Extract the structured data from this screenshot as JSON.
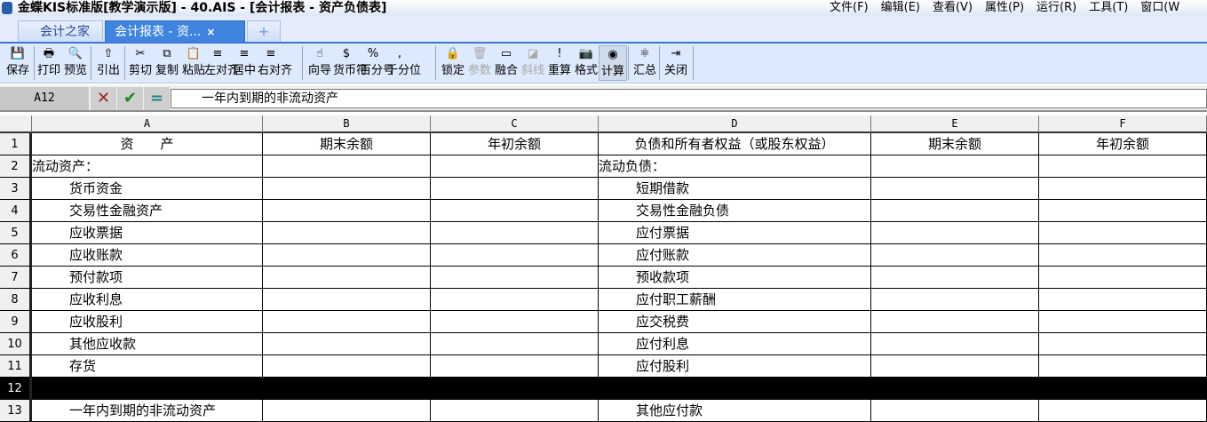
{
  "window": {
    "title": "金蝶KIS标准版[教学演示版] - 40.AIS - [会计报表 - 资产负债表]",
    "menu": [
      "文件(F)",
      "编辑(E)",
      "查看(V)",
      "属性(P)",
      "运行(R)",
      "工具(T)",
      "窗口(W"
    ]
  },
  "tabs": [
    {
      "label": "会计之家",
      "active": false
    },
    {
      "label": "会计报表 - 资...",
      "active": true,
      "close": "×"
    },
    {
      "label": "+",
      "new": true
    }
  ],
  "toolbar": [
    {
      "label": "保存",
      "icon": "save-icon",
      "glyph": "💾"
    },
    {
      "label": "打印",
      "icon": "print-icon",
      "glyph": "🖶"
    },
    {
      "label": "预览",
      "icon": "preview-icon",
      "glyph": "🔍"
    },
    {
      "label": "引出",
      "icon": "export-icon",
      "glyph": "⇧"
    },
    {
      "label": "剪切",
      "icon": "cut-icon",
      "glyph": "✂"
    },
    {
      "label": "复制",
      "icon": "copy-icon",
      "glyph": "⧉"
    },
    {
      "label": "粘贴",
      "icon": "paste-icon",
      "glyph": "📋"
    },
    {
      "label": "左对齐",
      "icon": "align-left-icon",
      "glyph": "≡"
    },
    {
      "label": "居中",
      "icon": "align-center-icon",
      "glyph": "≡"
    },
    {
      "label": "右对齐",
      "icon": "align-right-icon",
      "glyph": "≡"
    },
    {
      "label": "向导",
      "icon": "wizard-icon",
      "glyph": "☝"
    },
    {
      "label": "货币符",
      "icon": "currency-icon",
      "glyph": "$"
    },
    {
      "label": "百分号",
      "icon": "percent-icon",
      "glyph": "%"
    },
    {
      "label": "千分位",
      "icon": "thousands-icon",
      "glyph": ","
    },
    {
      "label": "锁定",
      "icon": "lock-icon",
      "glyph": "🔒"
    },
    {
      "label": "参数",
      "icon": "trash-icon",
      "glyph": "🗑",
      "disabled": true
    },
    {
      "label": "融合",
      "icon": "merge-icon",
      "glyph": "▭"
    },
    {
      "label": "斜线",
      "icon": "diagonal-icon",
      "glyph": "◪",
      "disabled": true
    },
    {
      "label": "重算",
      "icon": "recalc-icon",
      "glyph": "!"
    },
    {
      "label": "格式",
      "icon": "camera-icon",
      "glyph": "📷"
    },
    {
      "label": "计算",
      "icon": "calculate-icon",
      "glyph": "◉",
      "active": true
    },
    {
      "label": "汇总",
      "icon": "summary-icon",
      "glyph": "⚛"
    },
    {
      "label": "关闭",
      "icon": "exit-icon",
      "glyph": "⇥"
    }
  ],
  "formula": {
    "cell": "A12",
    "cancel": "✕",
    "confirm": "✔",
    "equals": "=",
    "value": "一年内到期的非流动资产"
  },
  "columns": [
    "A",
    "B",
    "C",
    "D",
    "E",
    "F"
  ],
  "rows": [
    {
      "n": "1",
      "cells": [
        "资　　产",
        "期末余额",
        "年初余额",
        "负债和所有者权益（或股东权益）",
        "期末余额",
        "年初余额"
      ]
    },
    {
      "n": "2",
      "cells": [
        "流动资产：",
        "",
        "",
        "流动负债：",
        "",
        ""
      ]
    },
    {
      "n": "3",
      "cells": [
        "货币资金",
        "",
        "",
        "短期借款",
        "",
        ""
      ]
    },
    {
      "n": "4",
      "cells": [
        "交易性金融资产",
        "",
        "",
        "交易性金融负债",
        "",
        ""
      ]
    },
    {
      "n": "5",
      "cells": [
        "应收票据",
        "",
        "",
        "应付票据",
        "",
        ""
      ]
    },
    {
      "n": "6",
      "cells": [
        "应收账款",
        "",
        "",
        "应付账款",
        "",
        ""
      ]
    },
    {
      "n": "7",
      "cells": [
        "预付款项",
        "",
        "",
        "预收款项",
        "",
        ""
      ]
    },
    {
      "n": "8",
      "cells": [
        "应收利息",
        "",
        "",
        "应付职工薪酬",
        "",
        ""
      ]
    },
    {
      "n": "9",
      "cells": [
        "应收股利",
        "",
        "",
        "应交税费",
        "",
        ""
      ]
    },
    {
      "n": "10",
      "cells": [
        "其他应收款",
        "",
        "",
        "应付利息",
        "",
        ""
      ]
    },
    {
      "n": "11",
      "cells": [
        "存货",
        "",
        "",
        "应付股利",
        "",
        ""
      ]
    },
    {
      "n": "12",
      "cells": [
        "",
        "",
        "",
        "",
        "",
        ""
      ],
      "selected": true
    },
    {
      "n": "13",
      "cells": [
        "一年内到期的非流动资产",
        "",
        "",
        "其他应付款",
        "",
        ""
      ]
    }
  ]
}
